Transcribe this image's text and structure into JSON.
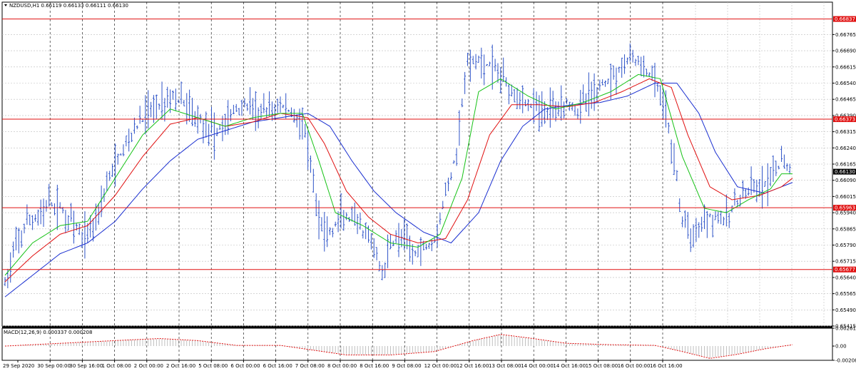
{
  "header": {
    "symbol_line": "NZDUSD,H1  0.66119 0.66133 0.66111 0.66130"
  },
  "macd_label": "MACD(12,26,9) 0.000337 0.000208",
  "colors": {
    "price": "#2f54c8",
    "ma_fast": "#16c216",
    "ma_mid": "#e01010",
    "ma_slow": "#1a2fd0",
    "level": "#e01010",
    "grid": "#000000",
    "macd_hist": "#b0b0b0",
    "macd_signal": "#e01010",
    "current_price_bg": "#000000"
  },
  "chart_data": [
    {
      "type": "bar",
      "title": "",
      "y_axis_labels": [
        "0.66765",
        "0.66690",
        "0.66615",
        "0.66540",
        "0.66465",
        "0.66390",
        "0.66315",
        "0.66240",
        "0.66165",
        "0.66090",
        "0.66015",
        "0.65940",
        "0.65865",
        "0.65790",
        "0.65715",
        "0.65640",
        "0.65565",
        "0.65490",
        "0.65415"
      ],
      "ylim": [
        0.65415,
        0.66915
      ],
      "x_axis_labels": [
        "29 Sep 2020",
        "30 Sep 00:00",
        "30 Sep 16:00",
        "1 Oct 08:00",
        "2 Oct 00:00",
        "2 Oct 16:00",
        "5 Oct 08:00",
        "6 Oct 00:00",
        "6 Oct 16:00",
        "7 Oct 08:00",
        "8 Oct 00:00",
        "8 Oct 16:00",
        "9 Oct 08:00",
        "12 Oct 00:00",
        "12 Oct 16:00",
        "13 Oct 08:00",
        "14 Oct 00:00",
        "14 Oct 16:00",
        "15 Oct 08:00",
        "16 Oct 00:00",
        "16 Oct 16:00"
      ],
      "horizontal_levels": [
        {
          "value": 0.66837,
          "label": "0.66837"
        },
        {
          "value": 0.66373,
          "label": "0.66373"
        },
        {
          "value": 0.65963,
          "label": "0.65963"
        },
        {
          "value": 0.65677,
          "label": "0.65677"
        }
      ],
      "current_price": {
        "value": 0.6613,
        "label": "0.66130"
      },
      "price_path": [
        [
          0,
          0.6561
        ],
        [
          4,
          0.6578
        ],
        [
          8,
          0.6589
        ],
        [
          12,
          0.6592
        ],
        [
          16,
          0.6598
        ],
        [
          20,
          0.6596
        ],
        [
          24,
          0.659
        ],
        [
          28,
          0.6582
        ],
        [
          32,
          0.6588
        ],
        [
          36,
          0.6604
        ],
        [
          40,
          0.6616
        ],
        [
          44,
          0.6626
        ],
        [
          48,
          0.6634
        ],
        [
          52,
          0.6641
        ],
        [
          56,
          0.6644
        ],
        [
          60,
          0.6648
        ],
        [
          64,
          0.6646
        ],
        [
          68,
          0.664
        ],
        [
          72,
          0.6636
        ],
        [
          76,
          0.663
        ],
        [
          80,
          0.6636
        ],
        [
          84,
          0.6642
        ],
        [
          88,
          0.6644
        ],
        [
          92,
          0.664
        ],
        [
          96,
          0.6641
        ],
        [
          100,
          0.6644
        ],
        [
          104,
          0.664
        ],
        [
          108,
          0.6636
        ],
        [
          110,
          0.6622
        ],
        [
          114,
          0.659
        ],
        [
          118,
          0.6584
        ],
        [
          122,
          0.6592
        ],
        [
          126,
          0.659
        ],
        [
          130,
          0.6585
        ],
        [
          134,
          0.6578
        ],
        [
          137,
          0.6565
        ],
        [
          140,
          0.658
        ],
        [
          144,
          0.6583
        ],
        [
          148,
          0.6576
        ],
        [
          152,
          0.6578
        ],
        [
          156,
          0.6582
        ],
        [
          160,
          0.6602
        ],
        [
          164,
          0.6622
        ],
        [
          166,
          0.6645
        ],
        [
          168,
          0.6662
        ],
        [
          172,
          0.6664
        ],
        [
          176,
          0.6662
        ],
        [
          180,
          0.6658
        ],
        [
          184,
          0.6652
        ],
        [
          188,
          0.6646
        ],
        [
          192,
          0.6643
        ],
        [
          196,
          0.664
        ],
        [
          200,
          0.6644
        ],
        [
          204,
          0.6646
        ],
        [
          208,
          0.6642
        ],
        [
          212,
          0.6648
        ],
        [
          216,
          0.6652
        ],
        [
          220,
          0.6657
        ],
        [
          224,
          0.6662
        ],
        [
          228,
          0.6666
        ],
        [
          232,
          0.666
        ],
        [
          236,
          0.6655
        ],
        [
          240,
          0.664
        ],
        [
          243,
          0.6618
        ],
        [
          246,
          0.659
        ],
        [
          250,
          0.6584
        ],
        [
          254,
          0.6592
        ],
        [
          258,
          0.6593
        ],
        [
          262,
          0.659
        ],
        [
          266,
          0.66
        ],
        [
          270,
          0.6603
        ],
        [
          274,
          0.6605
        ],
        [
          278,
          0.6608
        ],
        [
          282,
          0.6618
        ],
        [
          286,
          0.6613
        ]
      ],
      "price_bar_count": 286,
      "ma_fast_path": [
        [
          0,
          0.6565
        ],
        [
          10,
          0.658
        ],
        [
          20,
          0.6588
        ],
        [
          30,
          0.659
        ],
        [
          40,
          0.661
        ],
        [
          50,
          0.663
        ],
        [
          60,
          0.6642
        ],
        [
          70,
          0.6638
        ],
        [
          80,
          0.6634
        ],
        [
          90,
          0.6638
        ],
        [
          100,
          0.664
        ],
        [
          108,
          0.664
        ],
        [
          114,
          0.6618
        ],
        [
          120,
          0.6594
        ],
        [
          130,
          0.6588
        ],
        [
          140,
          0.658
        ],
        [
          150,
          0.6578
        ],
        [
          158,
          0.6584
        ],
        [
          166,
          0.661
        ],
        [
          172,
          0.665
        ],
        [
          180,
          0.6656
        ],
        [
          190,
          0.6648
        ],
        [
          200,
          0.6642
        ],
        [
          210,
          0.6645
        ],
        [
          220,
          0.665
        ],
        [
          230,
          0.6658
        ],
        [
          238,
          0.6656
        ],
        [
          246,
          0.662
        ],
        [
          254,
          0.6596
        ],
        [
          262,
          0.6594
        ],
        [
          270,
          0.66
        ],
        [
          278,
          0.6605
        ],
        [
          282,
          0.6612
        ],
        [
          286,
          0.6612
        ]
      ],
      "ma_mid_path": [
        [
          0,
          0.6562
        ],
        [
          10,
          0.6574
        ],
        [
          20,
          0.6584
        ],
        [
          30,
          0.6588
        ],
        [
          40,
          0.6602
        ],
        [
          50,
          0.662
        ],
        [
          60,
          0.6635
        ],
        [
          70,
          0.6638
        ],
        [
          80,
          0.6634
        ],
        [
          90,
          0.6636
        ],
        [
          100,
          0.664
        ],
        [
          110,
          0.6638
        ],
        [
          116,
          0.6626
        ],
        [
          124,
          0.6604
        ],
        [
          132,
          0.6592
        ],
        [
          140,
          0.6584
        ],
        [
          150,
          0.658
        ],
        [
          160,
          0.6582
        ],
        [
          168,
          0.66
        ],
        [
          176,
          0.663
        ],
        [
          184,
          0.6644
        ],
        [
          194,
          0.6644
        ],
        [
          204,
          0.6643
        ],
        [
          214,
          0.6645
        ],
        [
          224,
          0.665
        ],
        [
          234,
          0.6656
        ],
        [
          242,
          0.6652
        ],
        [
          248,
          0.663
        ],
        [
          256,
          0.6606
        ],
        [
          264,
          0.66
        ],
        [
          274,
          0.6602
        ],
        [
          282,
          0.6606
        ],
        [
          286,
          0.661
        ]
      ],
      "ma_slow_path": [
        [
          0,
          0.6555
        ],
        [
          10,
          0.6565
        ],
        [
          20,
          0.6575
        ],
        [
          30,
          0.658
        ],
        [
          40,
          0.659
        ],
        [
          50,
          0.6605
        ],
        [
          60,
          0.6618
        ],
        [
          70,
          0.6628
        ],
        [
          80,
          0.6632
        ],
        [
          90,
          0.6636
        ],
        [
          100,
          0.6638
        ],
        [
          110,
          0.664
        ],
        [
          118,
          0.6634
        ],
        [
          126,
          0.6618
        ],
        [
          134,
          0.6604
        ],
        [
          142,
          0.6594
        ],
        [
          152,
          0.6585
        ],
        [
          162,
          0.658
        ],
        [
          172,
          0.6594
        ],
        [
          180,
          0.6618
        ],
        [
          188,
          0.6634
        ],
        [
          196,
          0.6642
        ],
        [
          206,
          0.6644
        ],
        [
          216,
          0.6645
        ],
        [
          226,
          0.6648
        ],
        [
          236,
          0.6654
        ],
        [
          244,
          0.6654
        ],
        [
          252,
          0.664
        ],
        [
          258,
          0.6622
        ],
        [
          266,
          0.6606
        ],
        [
          276,
          0.6603
        ],
        [
          286,
          0.6608
        ]
      ]
    },
    {
      "type": "bar",
      "title": "",
      "y_axis_labels": [
        "0.00261",
        "0.00",
        "-0.00208"
      ],
      "ylim": [
        -0.00208,
        0.00261
      ],
      "signal_path": [
        [
          0,
          0.0
        ],
        [
          20,
          0.0004
        ],
        [
          40,
          0.0008
        ],
        [
          56,
          0.0011
        ],
        [
          70,
          0.0008
        ],
        [
          84,
          0.0001
        ],
        [
          100,
          0.0001
        ],
        [
          112,
          -0.0006
        ],
        [
          124,
          -0.0013
        ],
        [
          140,
          -0.0013
        ],
        [
          156,
          -0.0008
        ],
        [
          170,
          0.0008
        ],
        [
          180,
          0.0017
        ],
        [
          190,
          0.0012
        ],
        [
          204,
          0.0004
        ],
        [
          220,
          0.0002
        ],
        [
          236,
          0.0001
        ],
        [
          246,
          -0.0008
        ],
        [
          256,
          -0.0018
        ],
        [
          266,
          -0.0012
        ],
        [
          276,
          -0.0004
        ],
        [
          286,
          0.0002
        ]
      ]
    }
  ]
}
